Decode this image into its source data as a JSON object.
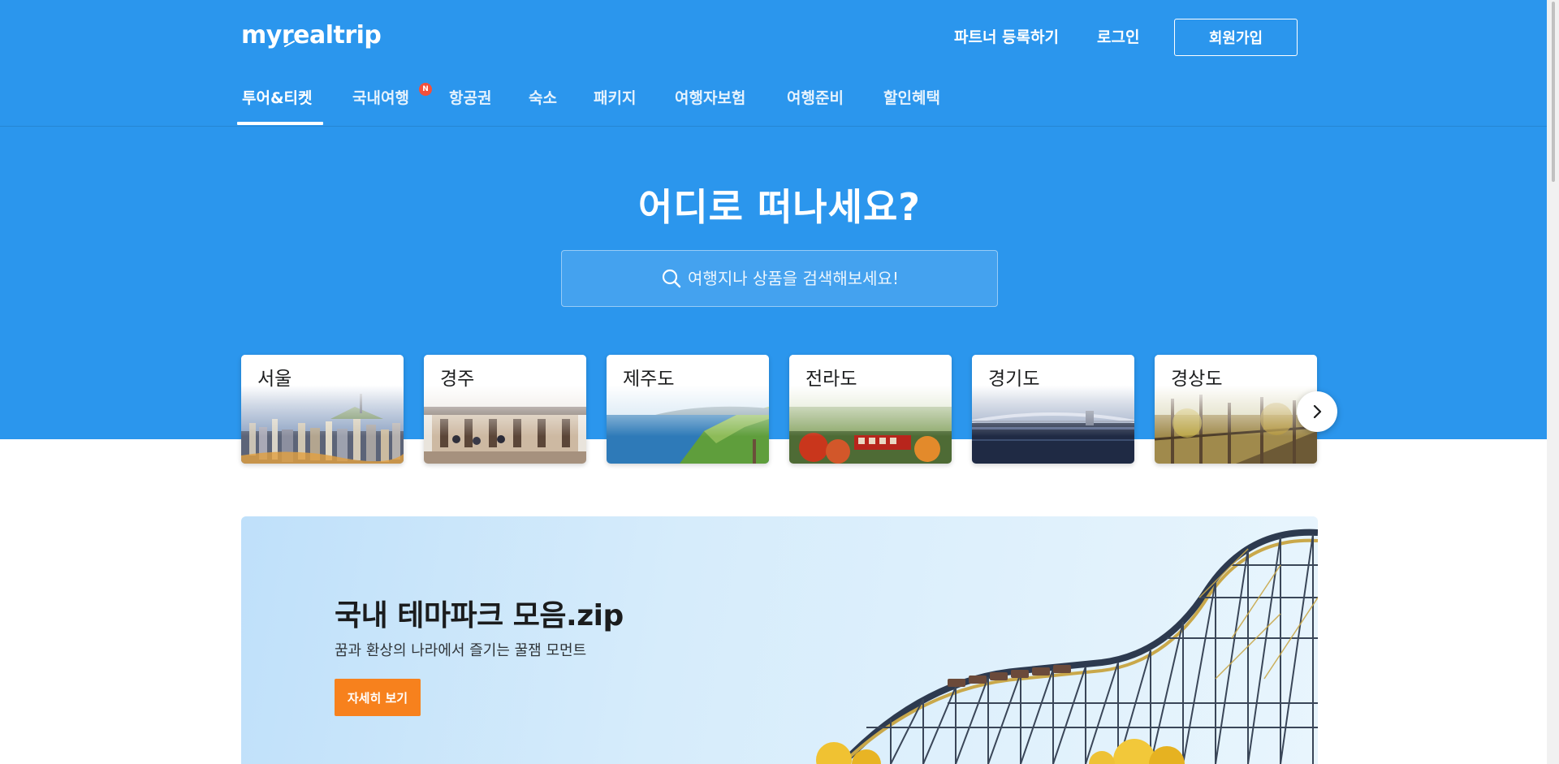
{
  "header": {
    "logo": "myrealtrip",
    "partner_link": "파트너 등록하기",
    "login_link": "로그인",
    "signup_button": "회원가입"
  },
  "nav": {
    "items": [
      {
        "label": "투어&티켓",
        "active": true
      },
      {
        "label": "국내여행",
        "badge": "N"
      },
      {
        "label": "항공권"
      },
      {
        "label": "숙소"
      },
      {
        "label": "패키지"
      },
      {
        "label": "여행자보험"
      },
      {
        "label": "여행준비"
      },
      {
        "label": "할인혜택"
      }
    ]
  },
  "hero": {
    "title": "어디로 떠나세요?",
    "search_placeholder": "여행지나 상품을 검색해보세요!"
  },
  "regions": [
    {
      "label": "서울"
    },
    {
      "label": "경주"
    },
    {
      "label": "제주도"
    },
    {
      "label": "전라도"
    },
    {
      "label": "경기도"
    },
    {
      "label": "경상도"
    }
  ],
  "banner": {
    "title": "국내 테마파크 모음.zip",
    "subtitle": "꿈과 환상의 나라에서 즐기는 꿀잼 모먼트",
    "button": "자세히 보기"
  },
  "colors": {
    "brand_blue": "#2b96ed",
    "accent_orange": "#f7811d",
    "badge_red": "#f4503b"
  },
  "icons": {
    "search": "search-icon",
    "next": "chevron-right-icon"
  }
}
